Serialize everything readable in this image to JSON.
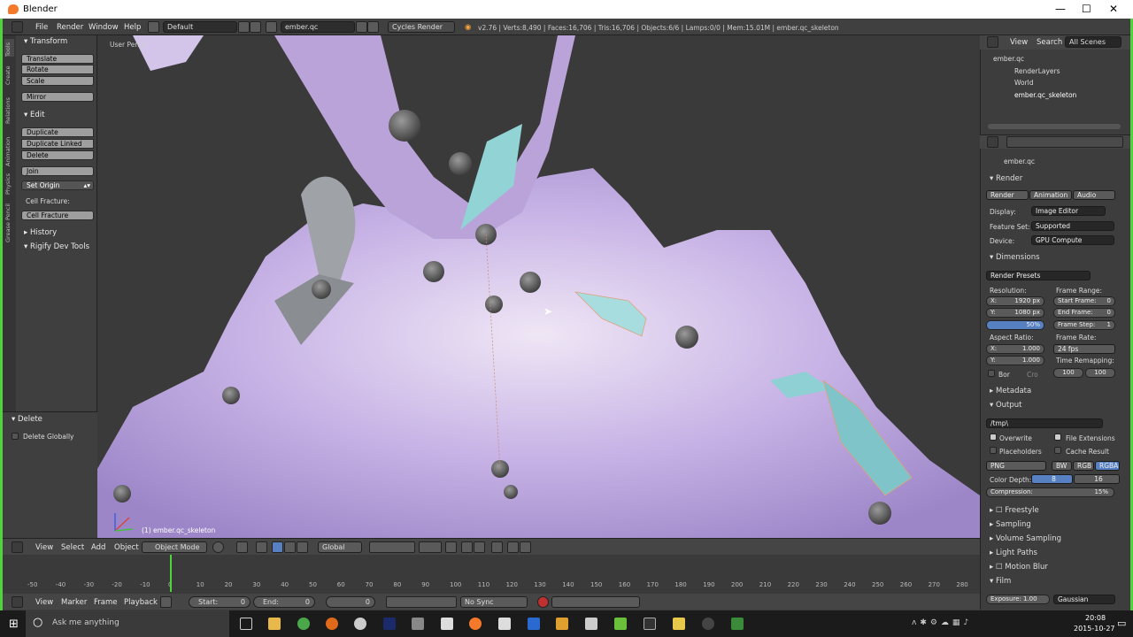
{
  "window": {
    "title": "Blender",
    "controls": [
      "—",
      "☐",
      "✕"
    ]
  },
  "info_header": {
    "menus": [
      "File",
      "Render",
      "Window",
      "Help"
    ],
    "layout": "Default",
    "scene": "ember.qc",
    "engine": "Cycles Render",
    "stats": "v2.76 | Verts:8,490 | Faces:16,706 | Tris:16,706 | Objects:6/6 | Lamps:0/0 | Mem:15.01M | ember.qc_skeleton"
  },
  "tool_shelf": {
    "tabs": [
      "Tools",
      "Create",
      "Relations",
      "Animation",
      "Physics",
      "Grease Pencil"
    ],
    "transform": {
      "header": "Transform",
      "buttons": [
        "Translate",
        "Rotate",
        "Scale"
      ],
      "mirror": "Mirror"
    },
    "edit": {
      "header": "Edit",
      "buttons": [
        "Duplicate",
        "Duplicate Linked",
        "Delete"
      ],
      "join": "Join",
      "set_origin": "Set Origin",
      "labels": [
        "Cell Fracture:",
        "Cell Fracture"
      ]
    },
    "history": "History",
    "rigify": "Rigify Dev Tools",
    "operator": {
      "header": "Delete",
      "checkbox": "Delete Globally"
    }
  },
  "viewport": {
    "view_name": "User Persp",
    "object_label": "(1) ember.qc_skeleton"
  },
  "viewport_header": {
    "menus": [
      "View",
      "Select",
      "Add",
      "Object"
    ],
    "mode": "Object Mode",
    "orientation": "Global"
  },
  "timeline": {
    "ruler": [
      "-50",
      "-40",
      "-30",
      "-20",
      "-10",
      "0",
      "10",
      "20",
      "30",
      "40",
      "50",
      "60",
      "70",
      "80",
      "90",
      "100",
      "110",
      "120",
      "130",
      "140",
      "150",
      "160",
      "170",
      "180",
      "190",
      "200",
      "210",
      "220",
      "230",
      "240",
      "250",
      "260",
      "270",
      "280"
    ],
    "current_frame": 0,
    "menus": [
      "View",
      "Marker",
      "Frame",
      "Playback"
    ],
    "start_label": "Start:",
    "start_value": "0",
    "end_label": "End:",
    "end_value": "0",
    "frame_value": "0",
    "sync": "No Sync"
  },
  "outliner": {
    "menus": [
      "View",
      "Search"
    ],
    "display": "All Scenes",
    "items": [
      "ember.qc",
      "RenderLayers",
      "World",
      "ember.qc_skeleton"
    ]
  },
  "properties": {
    "breadcrumb": "ember.qc",
    "render": {
      "header": "Render",
      "buttons": [
        "Render",
        "Animation",
        "Audio"
      ],
      "display_label": "Display:",
      "display": "Image Editor",
      "feature_label": "Feature Set:",
      "feature": "Supported",
      "device_label": "Device:",
      "device": "GPU Compute"
    },
    "dimensions": {
      "header": "Dimensions",
      "presets": "Render Presets",
      "resolution_label": "Resolution:",
      "res_x": "X:",
      "res_x_val": "1920 px",
      "res_y": "Y:",
      "res_y_val": "1080 px",
      "res_pct": "50%",
      "frame_range_label": "Frame Range:",
      "start_frame": "Start Frame:",
      "start_frame_val": "0",
      "end_frame": "End Frame:",
      "end_frame_val": "0",
      "frame_step": "Frame Step:",
      "frame_step_val": "1",
      "aspect_label": "Aspect Ratio:",
      "asp_x": "X:",
      "asp_x_val": "1.000",
      "asp_y": "Y:",
      "asp_y_val": "1.000",
      "frame_rate_label": "Frame Rate:",
      "frame_rate": "24 fps",
      "time_remap": "Time Remapping:",
      "remap_old": "100",
      "remap_new": "100",
      "border": "Bor",
      "crop": "Cro"
    },
    "metadata": "Metadata",
    "output": {
      "header": "Output",
      "path": "/tmp\\",
      "overwrite": "Overwrite",
      "file_ext": "File Extensions",
      "placeholders": "Placeholders",
      "cache": "Cache Result",
      "format": "PNG",
      "bw": "BW",
      "rgb": "RGB",
      "rgba": "RGBA",
      "depth_label": "Color Depth:",
      "depth8": "8",
      "depth16": "16",
      "compression": "Compression:",
      "compression_val": "15%"
    },
    "sections": [
      "Freestyle",
      "Sampling",
      "Volume Sampling",
      "Light Paths",
      "Motion Blur",
      "Film"
    ],
    "film": {
      "exposure": "Exposure: 1.00",
      "filter": "Gaussian"
    }
  },
  "taskbar": {
    "search": "Ask me anything",
    "time": "20:08",
    "date": "2015-10-27"
  },
  "colors": {
    "accent_blue": "#5680c2",
    "frame_green": "#4fd43c",
    "blender_orange": "#f5792a"
  }
}
